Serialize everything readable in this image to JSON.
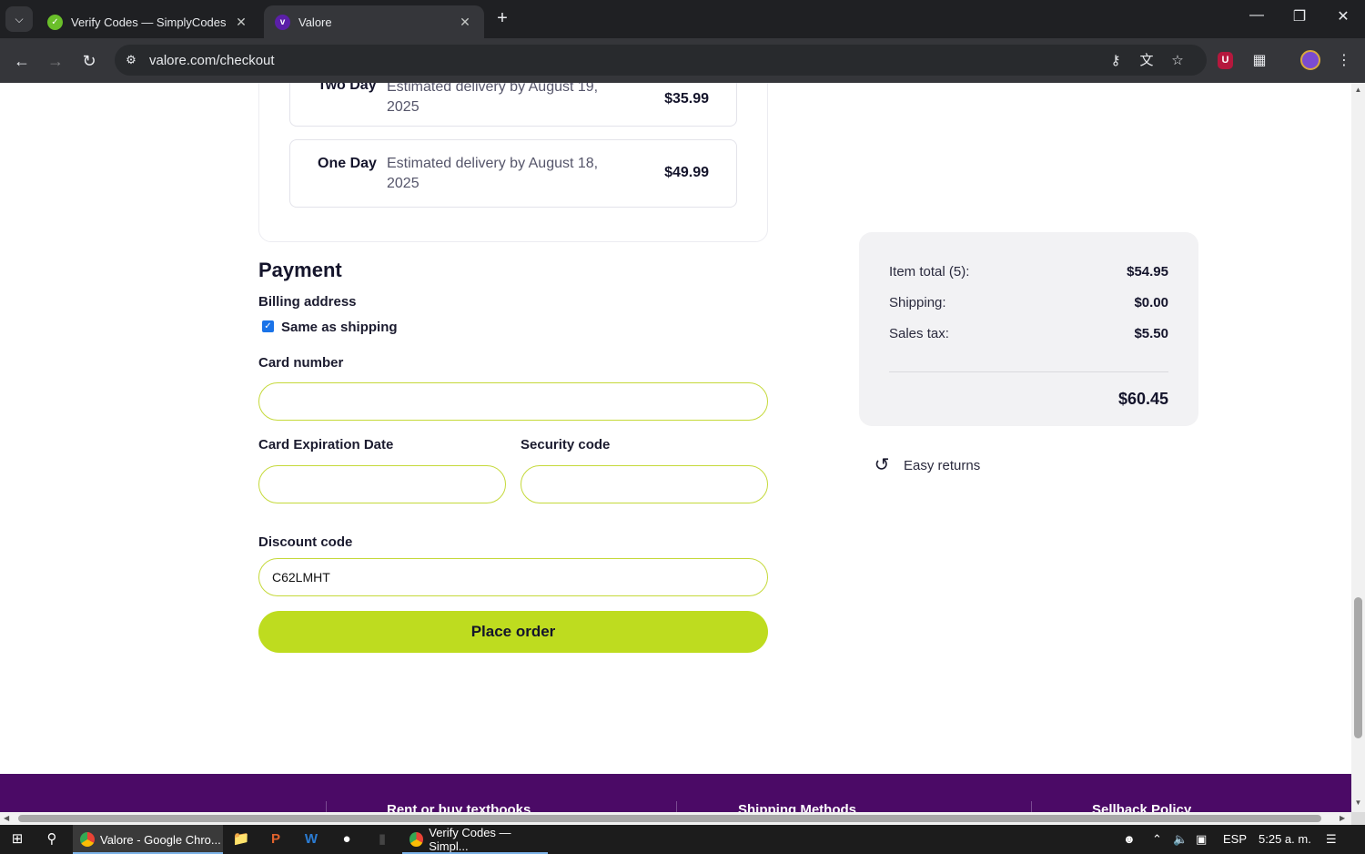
{
  "browser": {
    "tabs": [
      {
        "title": "Verify Codes — SimplyCodes",
        "active": false
      },
      {
        "title": "Valore",
        "active": true
      }
    ],
    "url": "valore.com/checkout"
  },
  "shipping": {
    "options": [
      {
        "name": "Two Day",
        "estimate": "Estimated delivery by August 19, 2025",
        "price": "$35.99"
      },
      {
        "name": "One Day",
        "estimate": "Estimated delivery by August 18, 2025",
        "price": "$49.99"
      }
    ]
  },
  "payment": {
    "heading": "Payment",
    "billing_label": "Billing address",
    "same_as_shipping_label": "Same as shipping",
    "same_as_shipping_checked": true,
    "card_number_label": "Card number",
    "card_number_value": "",
    "expiration_label": "Card Expiration Date",
    "expiration_value": "",
    "security_label": "Security code",
    "security_value": "",
    "discount_label": "Discount code",
    "discount_value": "C62LMHT",
    "place_order_label": "Place order",
    "field_border_color": "#c5d93a",
    "button_color": "#bedc1f"
  },
  "summary": {
    "rows": [
      {
        "label": "Item total (5):",
        "value": "$54.95"
      },
      {
        "label": "Shipping:",
        "value": "$0.00"
      },
      {
        "label": "Sales tax:",
        "value": "$5.50"
      }
    ],
    "total": "$60.45",
    "returns_label": "Easy returns",
    "returns_icon": "undo-arrow-icon"
  },
  "footer": {
    "links": [
      "Rent or buy textbooks",
      "Shipping Methods",
      "Sellback Policy"
    ],
    "background": "#4b0a66"
  },
  "taskbar": {
    "apps": [
      {
        "title": "Valore - Google Chro...",
        "active": true
      },
      {
        "title": "Verify Codes — Simpl...",
        "active": false
      }
    ],
    "language": "ESP",
    "time": "5:25 a. m."
  }
}
